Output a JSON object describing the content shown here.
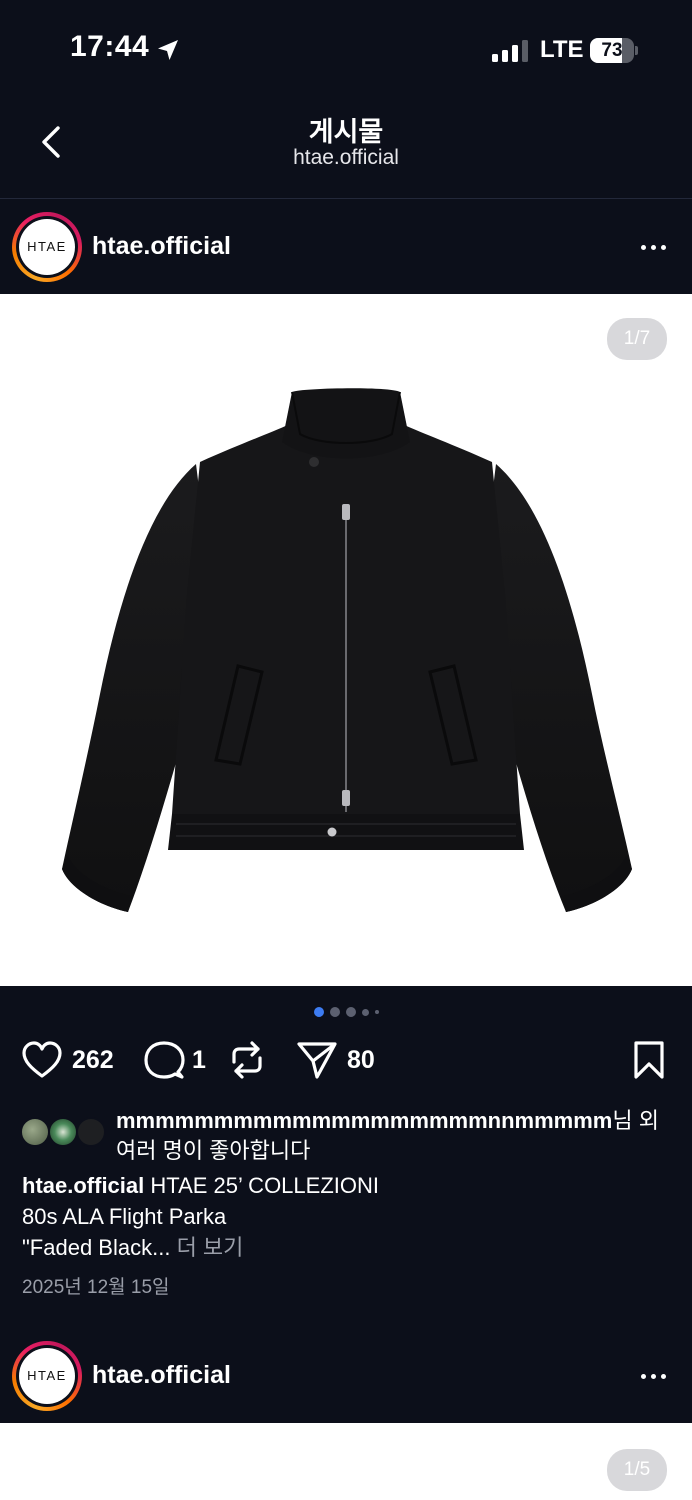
{
  "status_bar": {
    "time": "17:44",
    "network": "LTE",
    "battery": "73",
    "battery_level": 0.73
  },
  "nav": {
    "title": "게시물",
    "subtitle": "htae.official"
  },
  "post": {
    "username": "htae.official",
    "avatar_text": "HTAE",
    "image_counter": "1/7",
    "carousel": {
      "current": 1,
      "visible_dots": 5
    },
    "actions": {
      "likes": "262",
      "comments": "1",
      "shares": "80"
    },
    "liked_by": {
      "user": "mmmmmmmmmmmmmmmmmmmnnmmmmm",
      "suffix_line1": "님 외",
      "line2": "여러 명이 좋아합니다"
    },
    "caption": {
      "username": "htae.official",
      "line1": "HTAE 25’ COLLEZIONI",
      "line2": "80s ALA Flight Parka",
      "line3": "\"Faded Black...",
      "more": "더 보기"
    },
    "date": "2025년 12월 15일"
  },
  "next_post": {
    "username": "htae.official",
    "avatar_text": "HTAE",
    "image_counter": "1/5"
  },
  "icons": {
    "back": "chevron-left-icon",
    "more": "more-horizontal-icon",
    "like": "heart-icon",
    "comment": "comment-bubble-icon",
    "repost": "repost-icon",
    "share": "send-icon",
    "save": "bookmark-icon",
    "location": "location-arrow-icon"
  },
  "colors": {
    "background": "#0c0f1a",
    "active_dot": "#3d7cf2",
    "muted_text": "#9a9ea9"
  }
}
